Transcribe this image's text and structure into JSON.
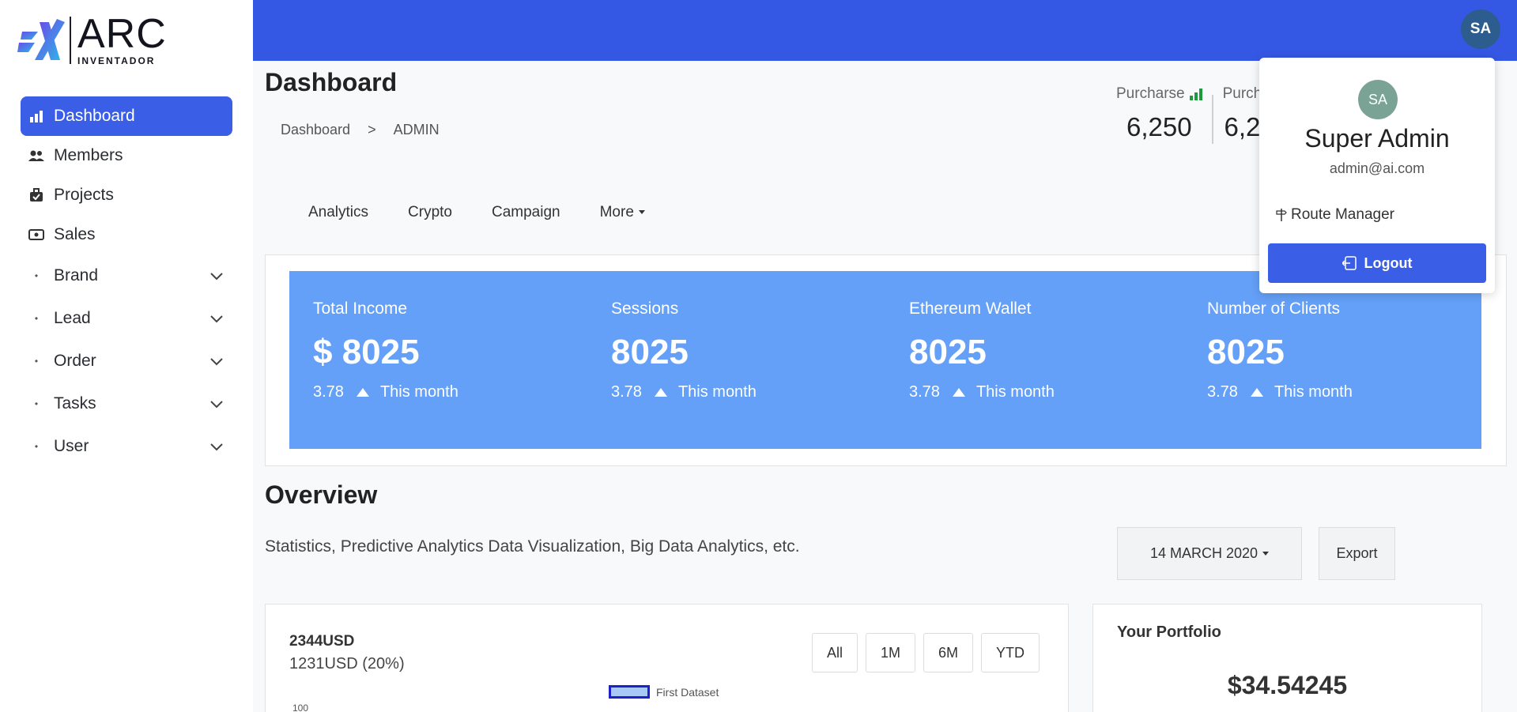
{
  "brand": {
    "name": "ARC",
    "tagline": "INVENTADOR"
  },
  "sidebar": {
    "items": [
      {
        "label": "Dashboard",
        "icon": "bar-chart-icon"
      },
      {
        "label": "Members",
        "icon": "users-icon"
      },
      {
        "label": "Projects",
        "icon": "briefcase-icon"
      },
      {
        "label": "Sales",
        "icon": "cash-icon"
      },
      {
        "label": "Brand",
        "icon": "dot"
      },
      {
        "label": "Lead",
        "icon": "dot"
      },
      {
        "label": "Order",
        "icon": "dot"
      },
      {
        "label": "Tasks",
        "icon": "dot"
      },
      {
        "label": "User",
        "icon": "dot"
      }
    ]
  },
  "topbar": {
    "avatar_initials": "SA"
  },
  "page": {
    "title": "Dashboard",
    "breadcrumb": [
      "Dashboard",
      ">",
      "ADMIN"
    ]
  },
  "top_stats": [
    {
      "label": "Purcharse",
      "value": "6,250"
    },
    {
      "label": "Purch",
      "value": "6,2"
    }
  ],
  "tabs": [
    "Analytics",
    "Crypto",
    "Campaign",
    "More"
  ],
  "kpis": [
    {
      "title": "Total Income",
      "value": "$ 8025",
      "change": "3.78",
      "period": "This month"
    },
    {
      "title": "Sessions",
      "value": "8025",
      "change": "3.78",
      "period": "This month"
    },
    {
      "title": "Ethereum Wallet",
      "value": "8025",
      "change": "3.78",
      "period": "This month"
    },
    {
      "title": "Number of Clients",
      "value": "8025",
      "change": "3.78",
      "period": "This month"
    }
  ],
  "overview": {
    "title": "Overview",
    "subtitle": "Statistics, Predictive Analytics Data Visualization, Big Data Analytics, etc.",
    "date_label": "14 MARCH 2020",
    "export_label": "Export"
  },
  "chart_card": {
    "title": "2344USD",
    "subtitle": "1231USD (20%)",
    "ranges": [
      "All",
      "1M",
      "6M",
      "YTD"
    ],
    "legend": "First Dataset",
    "ytick": "100"
  },
  "portfolio": {
    "title": "Your Portfolio",
    "value": "$34.54245"
  },
  "profile_menu": {
    "initials": "SA",
    "name": "Super Admin",
    "email": "admin@ai.com",
    "route_label": "Route Manager",
    "logout_label": "Logout"
  },
  "colors": {
    "primary": "#3558e4",
    "kpi_bg": "#64a0f7",
    "active_nav": "#3a5ee6"
  }
}
